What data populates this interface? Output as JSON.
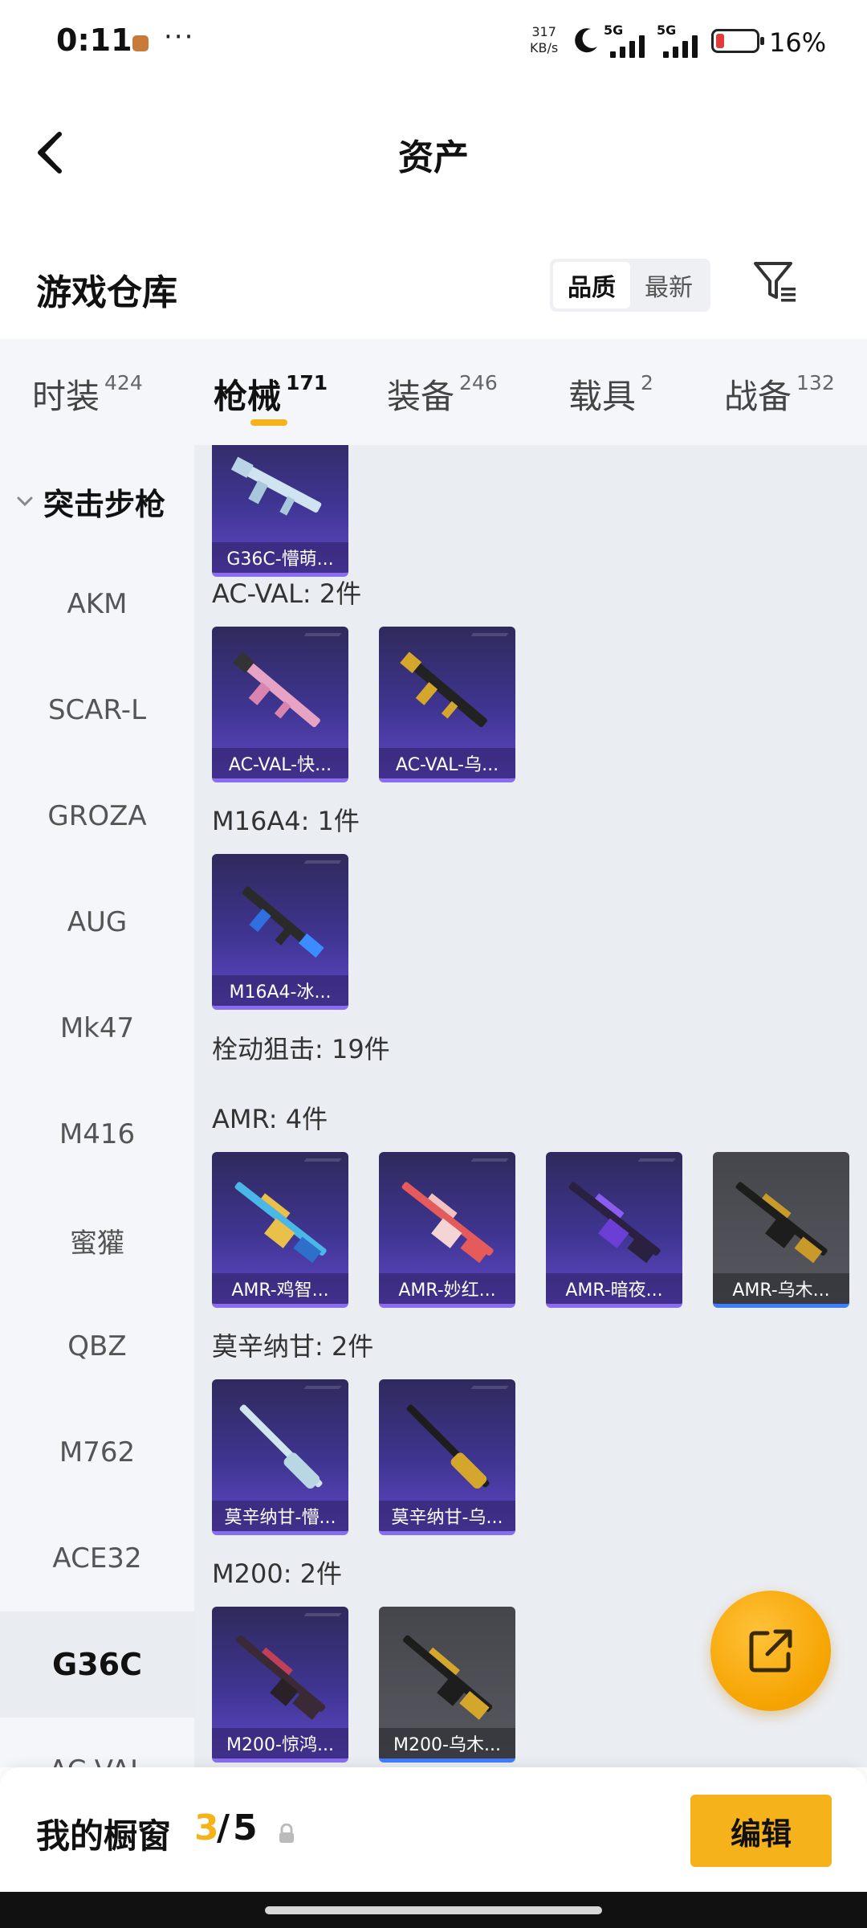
{
  "status_bar": {
    "time": "0:11",
    "more": "···",
    "net_speed_value": "317",
    "net_speed_unit": "KB/s",
    "signal_1": "5G",
    "signal_2": "5G",
    "battery_level": 0.16,
    "battery_text": "16%",
    "battery_color": "#e23b3b"
  },
  "header": {
    "title": "资产",
    "back_icon": "chevron-left-icon"
  },
  "warehouse": {
    "title": "游戏仓库",
    "sort_options": [
      "品质",
      "最新"
    ],
    "sort_selected": "品质",
    "filter_icon": "filter-icon"
  },
  "category_tabs": [
    {
      "name": "时装",
      "count": "424"
    },
    {
      "name": "枪械",
      "count": "171",
      "active": true
    },
    {
      "name": "装备",
      "count": "246"
    },
    {
      "name": "载具",
      "count": "2"
    },
    {
      "name": "战备",
      "count": "132"
    }
  ],
  "sidebar": {
    "group_label": "突击步枪",
    "items": [
      "AKM",
      "SCAR-L",
      "GROZA",
      "AUG",
      "Mk47",
      "M416",
      "蜜獾",
      "QBZ",
      "M762",
      "ACE32",
      "G36C",
      "AC-VAL"
    ],
    "active_item": "G36C"
  },
  "content": {
    "top_card": {
      "caption": "G36C-懵萌..."
    },
    "groups": [
      {
        "title": "AC-VAL: 2件",
        "cards": [
          {
            "caption": "AC-VAL-快..."
          },
          {
            "caption": "AC-VAL-乌..."
          }
        ]
      },
      {
        "title": "M16A4: 1件",
        "cards": [
          {
            "caption": "M16A4-冰..."
          }
        ]
      },
      {
        "title": "栓动狙击: 19件",
        "cards": []
      },
      {
        "title": "AMR: 4件",
        "cards": [
          {
            "caption": "AMR-鸡智..."
          },
          {
            "caption": "AMR-妙红..."
          },
          {
            "caption": "AMR-暗夜..."
          },
          {
            "caption": "AMR-乌木..."
          }
        ]
      },
      {
        "title": "莫辛纳甘: 2件",
        "cards": [
          {
            "caption": "莫辛纳甘-懵..."
          },
          {
            "caption": "莫辛纳甘-乌..."
          }
        ]
      },
      {
        "title": "M200: 2件",
        "cards": [
          {
            "caption": "M200-惊鸿..."
          },
          {
            "caption": "M200-乌木..."
          }
        ]
      }
    ]
  },
  "fab": {
    "icon": "share-icon"
  },
  "showcase": {
    "label": "我的橱窗",
    "current": "3",
    "separator": "/",
    "total": "5",
    "lock_icon": "lock-icon",
    "edit_label": "编辑"
  },
  "colors": {
    "accent": "#f5b21a",
    "card_purple": "#3f3592",
    "card_grey": "#57585f"
  }
}
